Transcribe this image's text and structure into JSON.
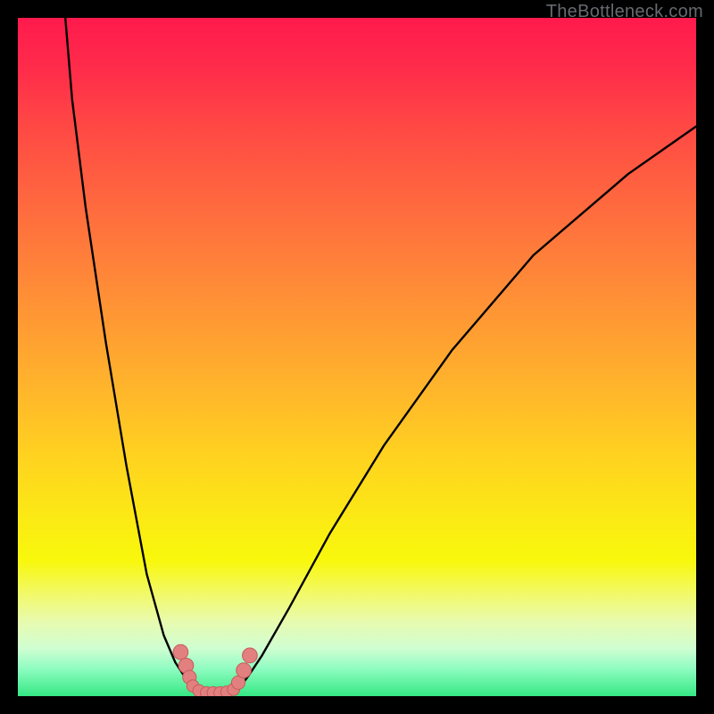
{
  "watermark": "TheBottleneck.com",
  "colors": {
    "frame": "#000000",
    "curve": "#000000",
    "marker_fill": "#e28080",
    "marker_stroke": "#c85a5a"
  },
  "chart_data": {
    "type": "line",
    "title": "",
    "xlabel": "",
    "ylabel": "",
    "xlim": [
      0,
      100
    ],
    "ylim": [
      0,
      100
    ],
    "grid": false,
    "legend": false,
    "series": [
      {
        "name": "curve_left",
        "x": [
          7.0,
          8.0,
          10.0,
          13.0,
          16.0,
          19.0,
          21.5,
          23.2,
          24.5,
          25.5
        ],
        "y": [
          100.0,
          88.0,
          72.0,
          52.0,
          34.0,
          18.0,
          9.0,
          5.0,
          3.0,
          1.0
        ]
      },
      {
        "name": "valley_floor",
        "x": [
          25.5,
          27.0,
          29.0,
          31.0,
          32.5
        ],
        "y": [
          1.0,
          0.5,
          0.5,
          0.5,
          1.0
        ]
      },
      {
        "name": "curve_right",
        "x": [
          32.5,
          34.0,
          36.0,
          40.0,
          46.0,
          54.0,
          64.0,
          76.0,
          90.0,
          100.0
        ],
        "y": [
          1.0,
          3.0,
          6.0,
          13.0,
          24.0,
          37.0,
          51.0,
          65.0,
          77.0,
          84.0
        ]
      }
    ],
    "markers": [
      {
        "x": 24.0,
        "y": 6.5,
        "r": 1.1
      },
      {
        "x": 24.8,
        "y": 4.5,
        "r": 1.1
      },
      {
        "x": 25.3,
        "y": 2.8,
        "r": 1.0
      },
      {
        "x": 25.8,
        "y": 1.5,
        "r": 0.9
      },
      {
        "x": 26.7,
        "y": 0.8,
        "r": 0.9
      },
      {
        "x": 27.8,
        "y": 0.5,
        "r": 0.9
      },
      {
        "x": 28.8,
        "y": 0.5,
        "r": 0.9
      },
      {
        "x": 29.8,
        "y": 0.5,
        "r": 0.9
      },
      {
        "x": 30.8,
        "y": 0.6,
        "r": 0.9
      },
      {
        "x": 31.8,
        "y": 1.0,
        "r": 0.9
      },
      {
        "x": 32.5,
        "y": 2.0,
        "r": 1.0
      },
      {
        "x": 33.3,
        "y": 3.8,
        "r": 1.1
      },
      {
        "x": 34.2,
        "y": 6.0,
        "r": 1.1
      }
    ]
  }
}
